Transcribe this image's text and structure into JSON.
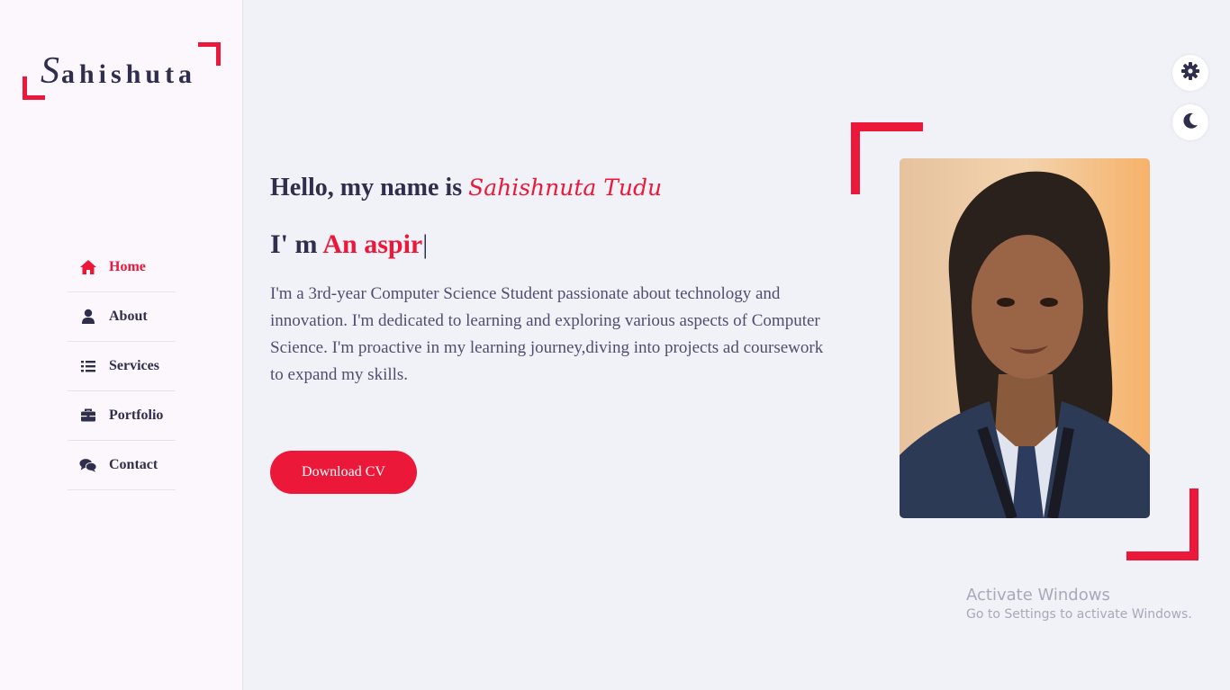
{
  "logo": {
    "first_letter": "S",
    "rest": "ahishuta"
  },
  "nav": {
    "items": [
      {
        "label": "Home",
        "icon": "home-icon",
        "active": true
      },
      {
        "label": "About",
        "icon": "user-icon"
      },
      {
        "label": "Services",
        "icon": "list-icon"
      },
      {
        "label": "Portfolio",
        "icon": "briefcase-icon"
      },
      {
        "label": "Contact",
        "icon": "comments-icon"
      }
    ]
  },
  "home": {
    "greeting": "Hello, my name is",
    "name": "Sahishnuta Tudu",
    "profession_prefix": "I' m",
    "profession_typed": "An aspir",
    "cursor": "|",
    "description": "I'm a 3rd-year Computer Science Student passionate about technology and innovation. I'm dedicated to learning and exploring various aspects of Computer Science. I'm proactive in my learning journey,diving into projects ad coursework to expand my skills.",
    "button_label": "Download CV"
  },
  "controls": {
    "settings_icon": "gear-icon",
    "theme_icon": "moon-icon"
  },
  "watermark": {
    "title": "Activate Windows",
    "subtitle": "Go to Settings to activate Windows."
  },
  "colors": {
    "accent": "#ec1839",
    "text": "#302e4d",
    "bg": "#f1f1f8",
    "sidebar_bg": "#fcf7fd"
  }
}
